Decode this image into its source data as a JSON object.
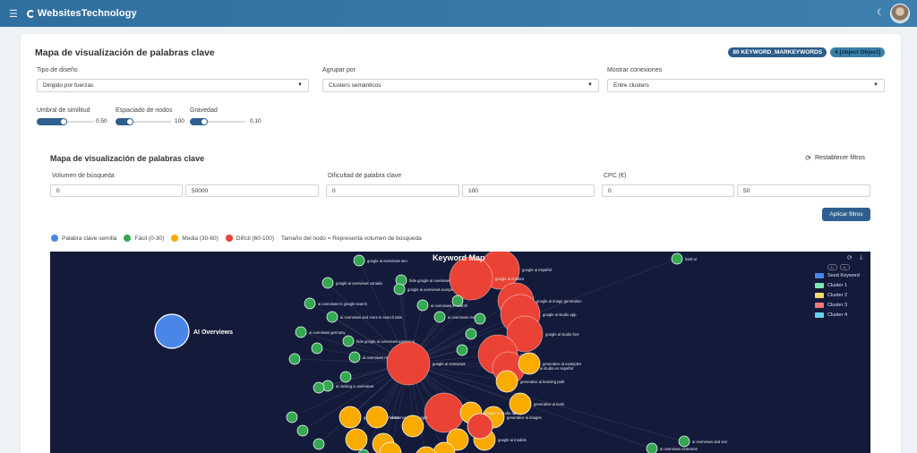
{
  "app": {
    "brand": "WebsitesTechnology"
  },
  "card": {
    "title": "Mapa de visualización de palabras clave",
    "badges": [
      "80 KEYWORD_MARKEYWORDS",
      "4 [object Object]"
    ]
  },
  "controls": {
    "design_label": "Tipo de diseño",
    "design_value": "Dirigido por fuerzas",
    "group_label": "Agrupar por",
    "group_value": "Clusters semánticos",
    "connections_label": "Mostrar conexiones",
    "connections_value": "Entre clusters",
    "similarity_label": "Umbral de similitud",
    "similarity_value": "0.50",
    "spacing_label": "Espaciado de nodos",
    "spacing_value": "100",
    "gravity_label": "Gravedad",
    "gravity_value": "0.10"
  },
  "filters": {
    "title": "Mapa de visualización de palabras clave",
    "reset_label": "Restablecer filtros",
    "volume_label": "Volumen de búsqueda",
    "volume_min": "0",
    "volume_max": "50000",
    "difficulty_label": "Dificultad de palabra clave",
    "difficulty_min": "0",
    "difficulty_max": "100",
    "cpc_label": "CPC (€)",
    "cpc_min": "0",
    "cpc_max": "50",
    "apply_label": "Aplicar filtros"
  },
  "legend": {
    "seed": "Palabra clave semilla",
    "easy": "Fácil (0-30)",
    "medium": "Media (30-60)",
    "hard": "Difícil (60-100)",
    "size_note": "Tamaño del nodo = Representa volumen de búsqueda",
    "colors": {
      "seed": "#4a86e8",
      "easy": "#34a853",
      "medium": "#f9ab00",
      "hard": "#ea4335"
    }
  },
  "graph": {
    "title": "Keyword Map",
    "seed_label": "AI Overviews",
    "cluster_legend": [
      {
        "label": "Seed Keyword",
        "color": "#4a86e8"
      },
      {
        "label": "Cluster 1",
        "color": "#7ee8b0"
      },
      {
        "label": "Cluster 2",
        "color": "#f9d86b"
      },
      {
        "label": "Cluster 3",
        "color": "#f07a7a"
      },
      {
        "label": "Cluster 4",
        "color": "#62d3e8"
      }
    ],
    "node_labels": [
      "google ai overviews seo",
      "hide google ai overviews",
      "google ai overviews canada",
      "google ai overviews europe",
      "ai overviews in google search",
      "ai overviews in search",
      "ai overviews and more in search labs",
      "ai overviews reddit",
      "ai overviews germany",
      "hide google ai overviews extension",
      "ai overviews news",
      "ai ranking in overviews",
      "google ai overviews",
      "google ai studio",
      "google ai español",
      "google ai chatbot",
      "google ai image generation",
      "google ai studio app",
      "google ai studio free",
      "google ai",
      "google ai studio en español",
      "generative ai examples",
      "generative ai learning path",
      "generative ai tools",
      "generative ai images",
      "google ai studio api",
      "google ai models",
      "bard ai",
      "ai overviews and seo",
      "ai overviews extension",
      "google ai search labs",
      "ai overviews of google"
    ]
  }
}
